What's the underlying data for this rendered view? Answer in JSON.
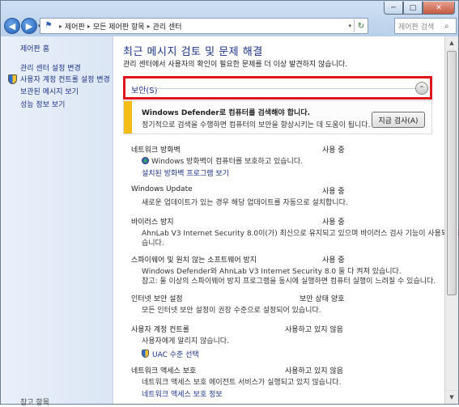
{
  "window": {
    "minimize_label": "─",
    "maximize_label": "□",
    "close_label": "✕"
  },
  "address": {
    "crumbs": [
      "제어판",
      "모든 제어판 항목",
      "관리 센터"
    ],
    "separator": "▸",
    "dropdown": "▾",
    "refresh": "↻"
  },
  "nav": {
    "back": "◀",
    "forward": "▶",
    "history": "▾"
  },
  "search": {
    "placeholder": "제어판 검색",
    "icon": "magnifier-icon"
  },
  "sidebar": {
    "home": "제어판 홈",
    "links": [
      "관리 센터 설정 변경",
      "사용자 계정 컨트롤 설정 변경",
      "보관된 메시지 보기",
      "성능 정보 보기"
    ],
    "bottom": "참고 항목"
  },
  "main": {
    "title": "최근 메시지 검토 및 문제 해결",
    "subtitle": "관리 센터에서 사용자의 확인이 필요한 문제를 더 이상 발견하지 않습니다.",
    "section": {
      "title": "보안(S)",
      "collapse_icon": "⌃"
    },
    "alert": {
      "head": "Windows Defender로 컴퓨터를 검색해야 합니다.",
      "body": "정기적으로 검색을 수행하면 컴퓨터의 보안을 향상시키는 데 도움이 됩니다.",
      "button": "지금 검사(A)",
      "stripe_color": "#f3bd15"
    },
    "items": [
      {
        "name": "네트워크 방화벽",
        "status": "사용 중",
        "desc": "Windows 방화벽이 컴퓨터를 보호하고 있습니다.",
        "link": "설치된 방화벽 프로그램 보기"
      },
      {
        "name": "Windows Update",
        "status": "사용 중",
        "desc": "새로운 업데이트가 있는 경우 해당 업데이트를 자동으로 설치합니다."
      },
      {
        "name": "바이러스 방지",
        "status": "사용 중",
        "desc": "AhnLab V3 Internet Security 8.0이(가) 최신으로 유지되고 있으며 바이러스 검사 기능이 사용되고 있",
        "desc2": "습니다."
      },
      {
        "name": "스파이웨어 및 원치 않는 소프트웨어 방지",
        "status": "사용 중",
        "desc": "Windows Defender와 AhnLab V3 Internet Security 8.0 둘 다 켜져 있습니다.",
        "desc2": "참고: 둘 이상의 스파이웨어 방지 프로그램을 동시에 실행하면 컴퓨터 실행이 느려질 수 있습니다."
      },
      {
        "name": "인터넷 보안 설정",
        "status": "보안 상태 양호",
        "desc": "모든 인터넷 보안 설정이 권장 수준으로 설정되어 있습니다."
      },
      {
        "name": "사용자 계정 컨트롤",
        "status": "사용하고 있지 않음",
        "desc": "사용자에게 알리지 않습니다.",
        "link": "UAC 수준 선택"
      },
      {
        "name": "네트워크 액세스 보호",
        "status": "사용하고 있지 않음",
        "desc": "네트워크 액세스 보호 에이전트 서비스가 실행되고 있지 않습니다.",
        "link": "네트워크 액세스 보호 정보"
      }
    ]
  },
  "scrollbar": {
    "up": "▲",
    "down": "▼"
  }
}
